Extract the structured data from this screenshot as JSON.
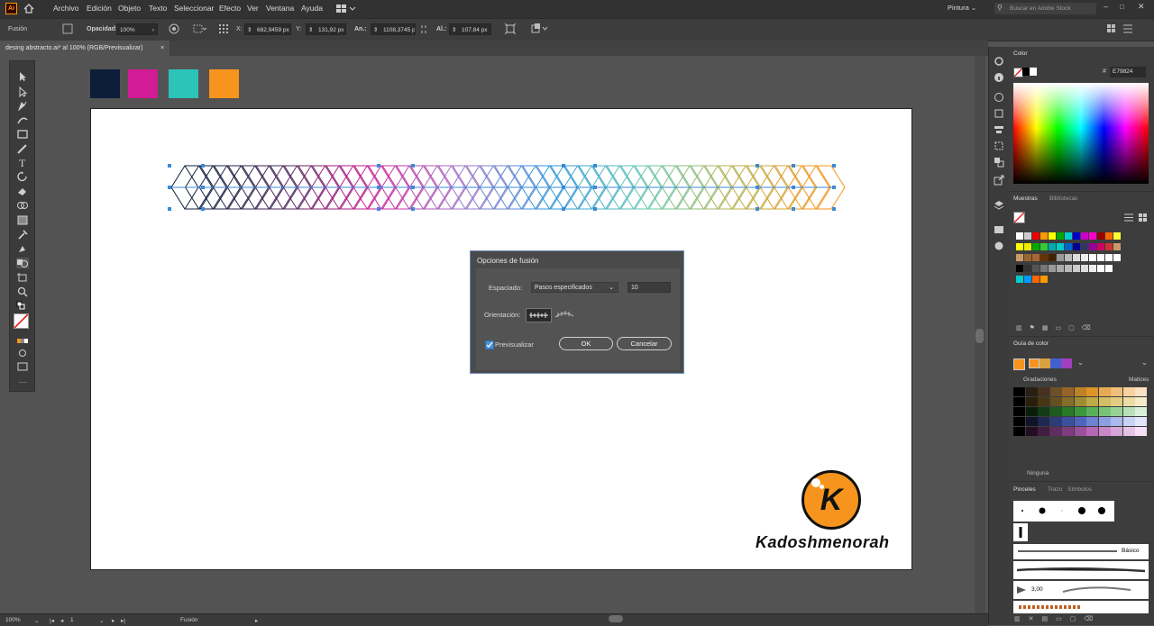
{
  "app": {
    "logo": "Ai"
  },
  "menu": {
    "items": [
      "Archivo",
      "Edición",
      "Objeto",
      "Texto",
      "Seleccionar",
      "Efecto",
      "Ver",
      "Ventana",
      "Ayuda"
    ],
    "workspace": "Pintura",
    "search_placeholder": "Buscar en Adobe Stock"
  },
  "control": {
    "selection_label": "Fusión",
    "opacity_label": "Opacidad:",
    "opacity_value": "100%",
    "x_label": "X:",
    "x_value": "682,9459 px",
    "y_label": "Y:",
    "y_value": "131,92 px",
    "w_label": "An.:",
    "w_value": "1108,3745 p",
    "h_label": "Al.:",
    "h_value": "107,84 px"
  },
  "document": {
    "tab_title": "desing abstracto.ai* al 100% (RGB/Previsualizar)",
    "close": "×"
  },
  "top_swatches": [
    "#0c1e3a",
    "#d21b96",
    "#2cc3b9",
    "#f7941d"
  ],
  "dialog": {
    "title": "Opciones de fusión",
    "spacing_label": "Espaciado:",
    "spacing_value": "Pasos especificados",
    "steps_value": "10",
    "orientation_label": "Orientación:",
    "preview_label": "Previsualizar",
    "ok_label": "OK",
    "cancel_label": "Cancelar"
  },
  "logo": {
    "letter": "K",
    "name": "Kadoshmenorah"
  },
  "status": {
    "zoom": "100%",
    "artboard": "1",
    "tool": "Fusión"
  },
  "color_panel": {
    "tab": "Color",
    "hex": "E79824"
  },
  "swatches_panel": {
    "tabs": [
      "Muestras",
      "Bibliotecas"
    ]
  },
  "guide_panel": {
    "tab": "Guía de color",
    "gradations": "Gradaciones",
    "shades": "Matices",
    "none_label": "Ninguna"
  },
  "brushes_panel": {
    "tabs": [
      "Pinceles",
      "Trazo",
      "Símbolos"
    ],
    "basic_label": "Básico",
    "size_label": "3,00"
  }
}
